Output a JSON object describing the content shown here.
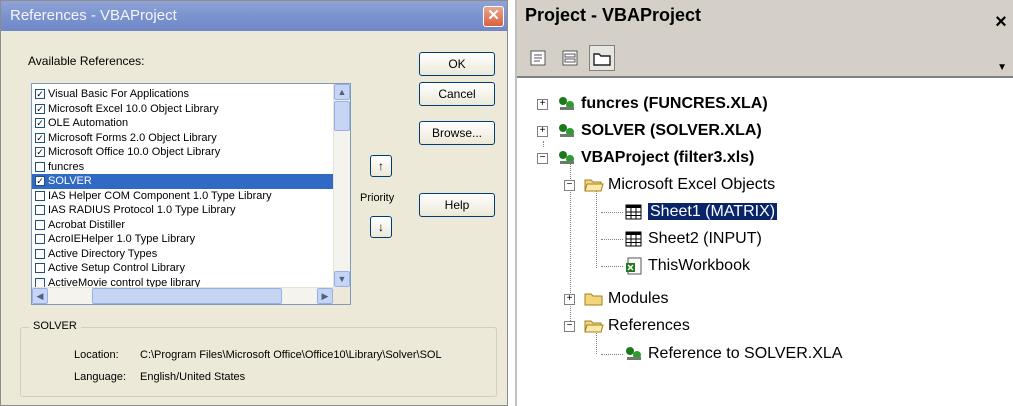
{
  "references_dialog": {
    "title": "References - VBAProject",
    "available_label": "Available References:",
    "items": [
      {
        "label": "Visual Basic For Applications",
        "checked": true,
        "selected": false
      },
      {
        "label": "Microsoft Excel 10.0 Object Library",
        "checked": true,
        "selected": false
      },
      {
        "label": "OLE Automation",
        "checked": true,
        "selected": false
      },
      {
        "label": "Microsoft Forms 2.0 Object Library",
        "checked": true,
        "selected": false
      },
      {
        "label": "Microsoft Office 10.0 Object Library",
        "checked": true,
        "selected": false
      },
      {
        "label": "funcres",
        "checked": false,
        "selected": false
      },
      {
        "label": "SOLVER",
        "checked": true,
        "selected": true
      },
      {
        "label": "IAS Helper COM Component 1.0 Type Library",
        "checked": false,
        "selected": false
      },
      {
        "label": "IAS RADIUS Protocol 1.0 Type Library",
        "checked": false,
        "selected": false
      },
      {
        "label": "Acrobat Distiller",
        "checked": false,
        "selected": false
      },
      {
        "label": "AcroIEHelper 1.0 Type Library",
        "checked": false,
        "selected": false
      },
      {
        "label": "Active Directory Types",
        "checked": false,
        "selected": false
      },
      {
        "label": "Active Setup Control Library",
        "checked": false,
        "selected": false
      },
      {
        "label": "ActiveMovie control type library",
        "checked": false,
        "selected": false
      }
    ],
    "buttons": {
      "ok": "OK",
      "cancel": "Cancel",
      "browse": "Browse...",
      "help": "Help"
    },
    "priority_label": "Priority",
    "priority_up": "↑",
    "priority_down": "↓",
    "group_title": "SOLVER",
    "location_label": "Location:",
    "location_value": "C:\\Program Files\\Microsoft Office\\Office10\\Library\\Solver\\SOL",
    "language_label": "Language:",
    "language_value": "English/United States"
  },
  "project_explorer": {
    "title": "Project - VBAProject",
    "close": "×",
    "toolbar": [
      "view-code-icon",
      "view-object-icon",
      "toggle-folders-icon"
    ],
    "tree": {
      "funcres": "funcres (FUNCRES.XLA)",
      "solver": "SOLVER (SOLVER.XLA)",
      "vbaproject": "VBAProject (filter3.xls)",
      "excel_objects": "Microsoft Excel Objects",
      "sheet1": "Sheet1 (MATRIX)",
      "sheet2": "Sheet2 (INPUT)",
      "thisworkbook": "ThisWorkbook",
      "modules": "Modules",
      "references": "References",
      "reference_solver": "Reference to SOLVER.XLA"
    }
  }
}
